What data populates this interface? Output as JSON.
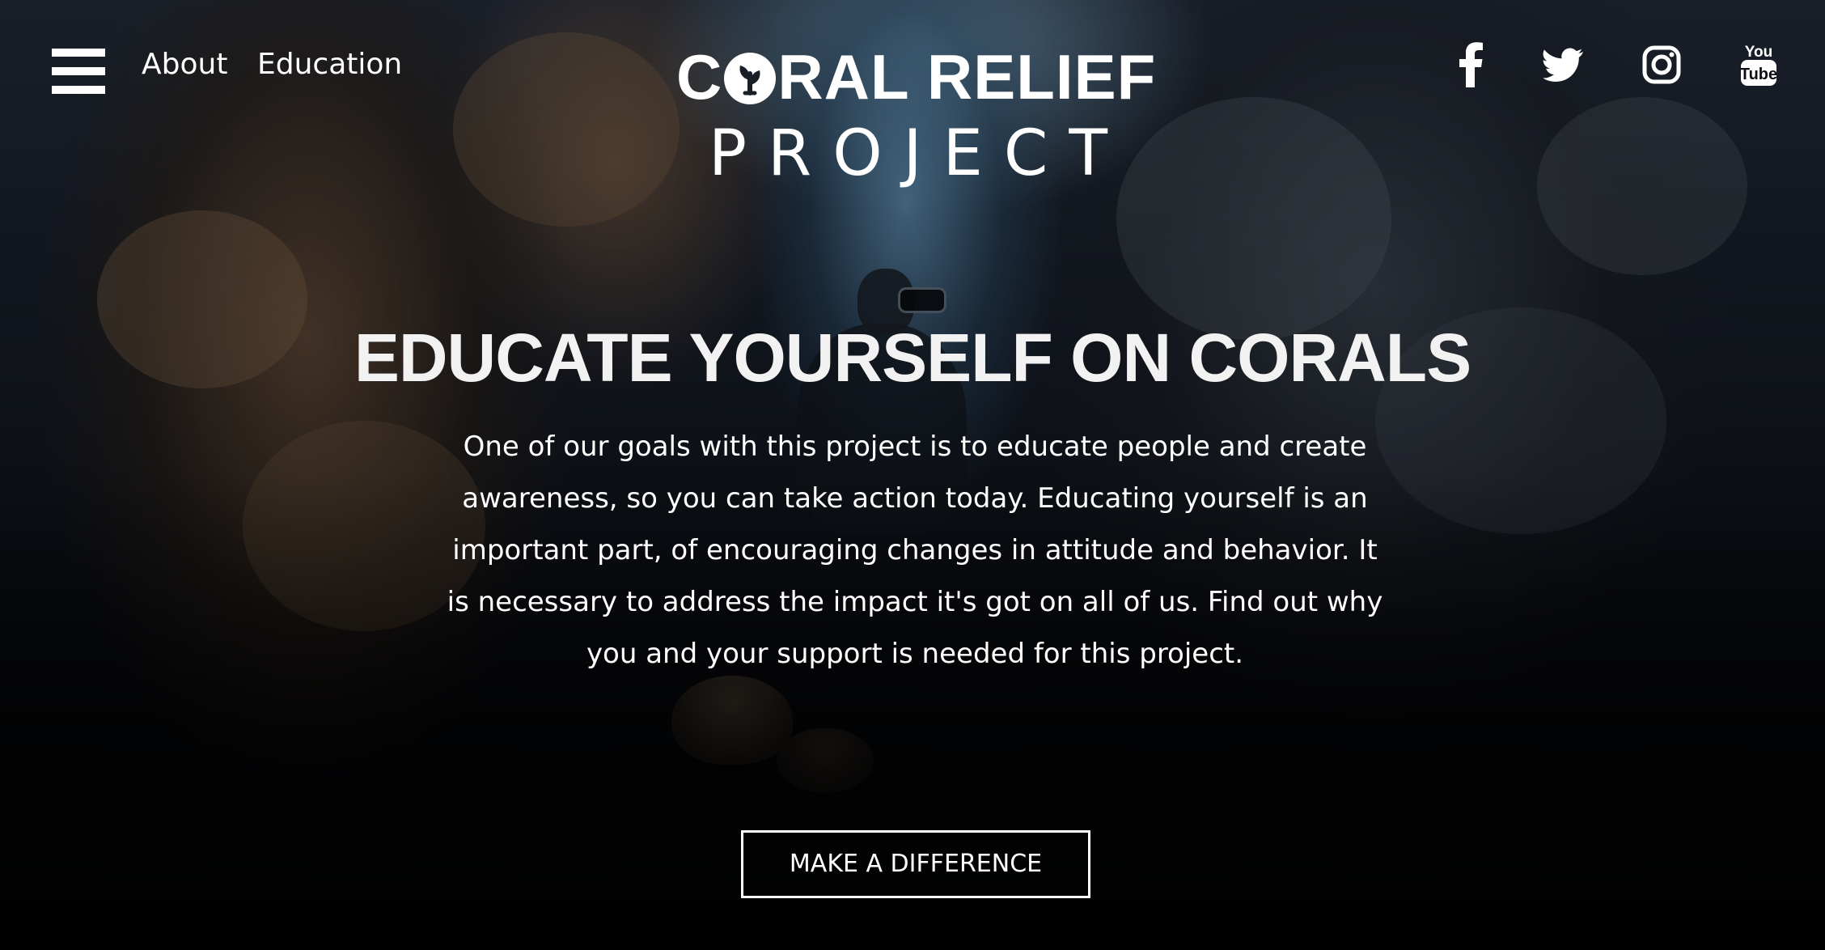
{
  "header": {
    "menu_icon": "hamburger-menu-icon",
    "nav": [
      {
        "label": "About"
      },
      {
        "label": "Education"
      }
    ],
    "logo": {
      "line1_first": "C",
      "line1_rest": "RAL RELIEF",
      "line2": "PROJECT",
      "emblem_icon": "coral-leaf-icon"
    },
    "social": [
      {
        "name": "facebook",
        "icon": "facebook-icon"
      },
      {
        "name": "twitter",
        "icon": "twitter-icon"
      },
      {
        "name": "instagram",
        "icon": "instagram-icon"
      },
      {
        "name": "youtube",
        "icon": "youtube-icon",
        "text_top": "You",
        "text_bottom": "Tube"
      }
    ]
  },
  "main": {
    "headline": "EDUCATE YOURSELF ON CORALS",
    "body": "One of our goals with this project is to educate people and create awareness, so you can take action today. Educating yourself is an important part, of encouraging changes in attitude and behavior. It is necessary to address the impact it's got on all of us. Find out why you and your support is needed for this project.",
    "cta_label": "MAKE A DIFFERENCE"
  },
  "colors": {
    "text": "#ffffff",
    "background_dark": "#07080c",
    "water_blue": "#5a87aa",
    "rock_brown": "#5f4632"
  }
}
